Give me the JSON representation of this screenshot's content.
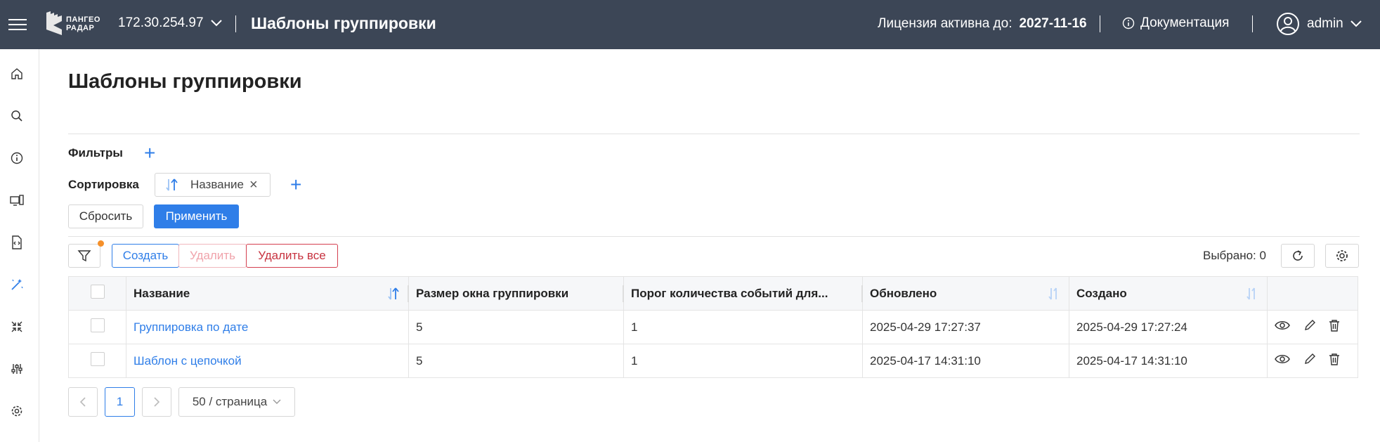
{
  "header": {
    "logo_line1": "ПАНГЕО",
    "logo_line2": "РАДАР",
    "ip": "172.30.254.97",
    "title": "Шаблоны группировки",
    "license_label": "Лицензия активна до:",
    "license_date": "2027-11-16",
    "docs": "Документация",
    "user": "admin"
  },
  "sidebar": {
    "items": [
      "home-icon",
      "search-icon",
      "info-icon",
      "devices-icon",
      "code-file-icon",
      "magic-wand-icon",
      "collapse-icon",
      "sliders-icon",
      "gear-icon"
    ]
  },
  "page": {
    "title": "Шаблоны группировки",
    "filters_label": "Фильтры",
    "sort_label": "Сортировка",
    "sort_chip": "Название",
    "reset": "Сбросить",
    "apply": "Применить"
  },
  "toolbar": {
    "create": "Создать",
    "delete": "Удалить",
    "delete_all": "Удалить все",
    "selected": "Выбрано: 0"
  },
  "table": {
    "columns": [
      "Название",
      "Размер окна группировки",
      "Порог количества событий для...",
      "Обновлено",
      "Создано"
    ],
    "rows": [
      {
        "name": "Группировка по дате",
        "window": "5",
        "threshold": "1",
        "updated": "2025-04-29 17:27:37",
        "created": "2025-04-29 17:27:24"
      },
      {
        "name": "Шаблон с цепочкой",
        "window": "5",
        "threshold": "1",
        "updated": "2025-04-17 14:31:10",
        "created": "2025-04-17 14:31:10"
      }
    ]
  },
  "pagination": {
    "current": "1",
    "page_size": "50 / страница"
  },
  "colors": {
    "topbar": "#3c4656",
    "accent": "#2f7ee8",
    "danger": "#d43f4f",
    "badge": "#f5902a"
  }
}
